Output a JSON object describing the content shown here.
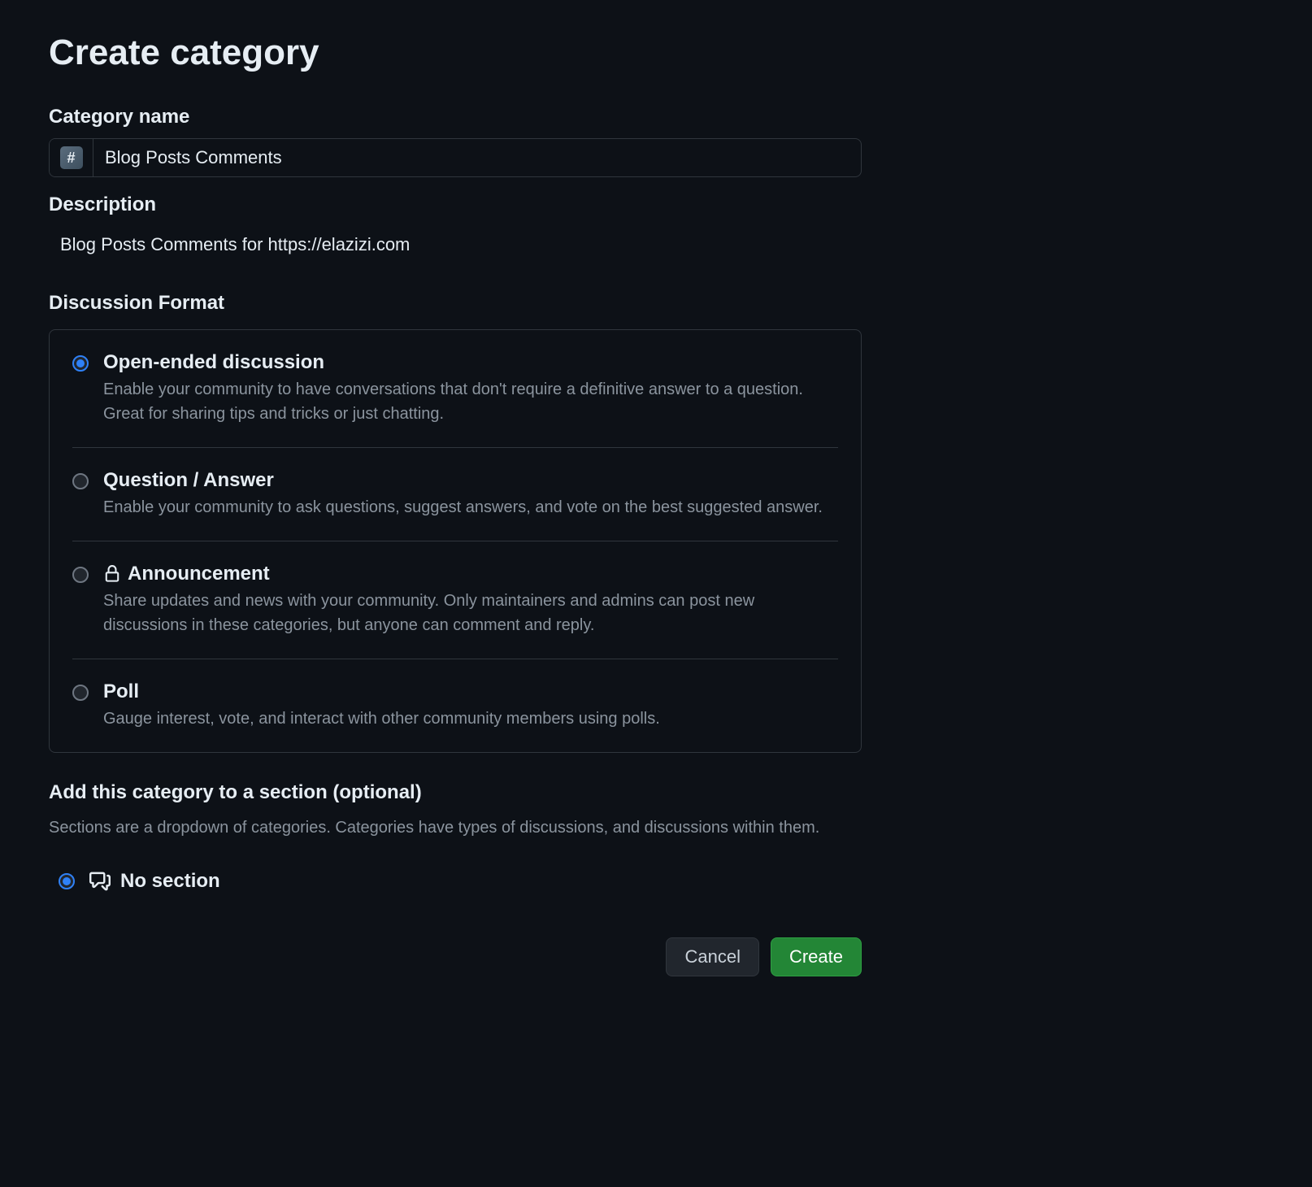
{
  "title": "Create category",
  "fields": {
    "category_name_label": "Category name",
    "category_name_value": "Blog Posts Comments",
    "description_label": "Description",
    "description_value": "Blog Posts Comments for https://elazizi.com"
  },
  "discussion_format": {
    "label": "Discussion Format",
    "options": [
      {
        "title": "Open-ended discussion",
        "desc": "Enable your community to have conversations that don't require a definitive answer to a question. Great for sharing tips and tricks or just chatting.",
        "checked": true
      },
      {
        "title": "Question / Answer",
        "desc": "Enable your community to ask questions, suggest answers, and vote on the best suggested answer.",
        "checked": false
      },
      {
        "title": "Announcement",
        "desc": "Share updates and news with your community. Only maintainers and admins can post new discussions in these categories, but anyone can comment and reply.",
        "checked": false
      },
      {
        "title": "Poll",
        "desc": "Gauge interest, vote, and interact with other community members using polls.",
        "checked": false
      }
    ]
  },
  "section": {
    "label": "Add this category to a section (optional)",
    "sublabel": "Sections are a dropdown of categories. Categories have types of discussions, and discussions within them.",
    "no_section_label": "No section"
  },
  "buttons": {
    "cancel": "Cancel",
    "create": "Create"
  },
  "icons": {
    "hash": "#"
  }
}
